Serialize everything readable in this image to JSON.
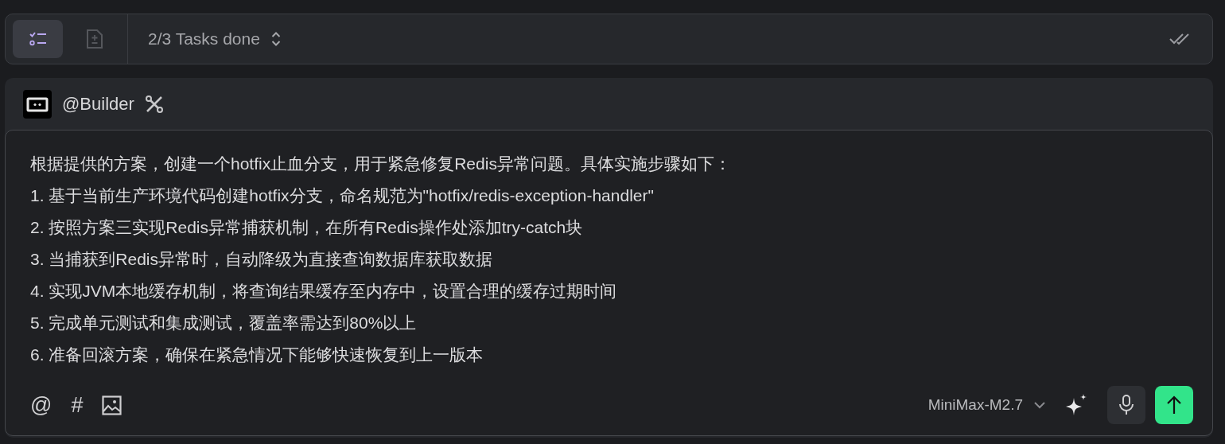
{
  "task_bar": {
    "tabs": [
      {
        "kind": "checklist",
        "selected": true
      },
      {
        "kind": "document",
        "selected": false
      }
    ],
    "status": "2/3 Tasks done"
  },
  "agent": {
    "name": "@Builder"
  },
  "prompt": {
    "lines": [
      "根据提供的方案，创建一个hotfix止血分支，用于紧急修复Redis异常问题。具体实施步骤如下：",
      "1. 基于当前生产环境代码创建hotfix分支，命名规范为\"hotfix/redis-exception-handler\"",
      "2. 按照方案三实现Redis异常捕获机制，在所有Redis操作处添加try-catch块",
      "3. 当捕获到Redis异常时，自动降级为直接查询数据库获取数据",
      "4. 实现JVM本地缓存机制，将查询结果缓存至内存中，设置合理的缓存过期时间",
      "5. 完成单元测试和集成测试，覆盖率需达到80%以上",
      "6. 准备回滚方案，确保在紧急情况下能够快速恢复到上一版本"
    ]
  },
  "toolbar": {
    "tools": [
      "@",
      "#"
    ],
    "model": "MiniMax-M2.7"
  }
}
